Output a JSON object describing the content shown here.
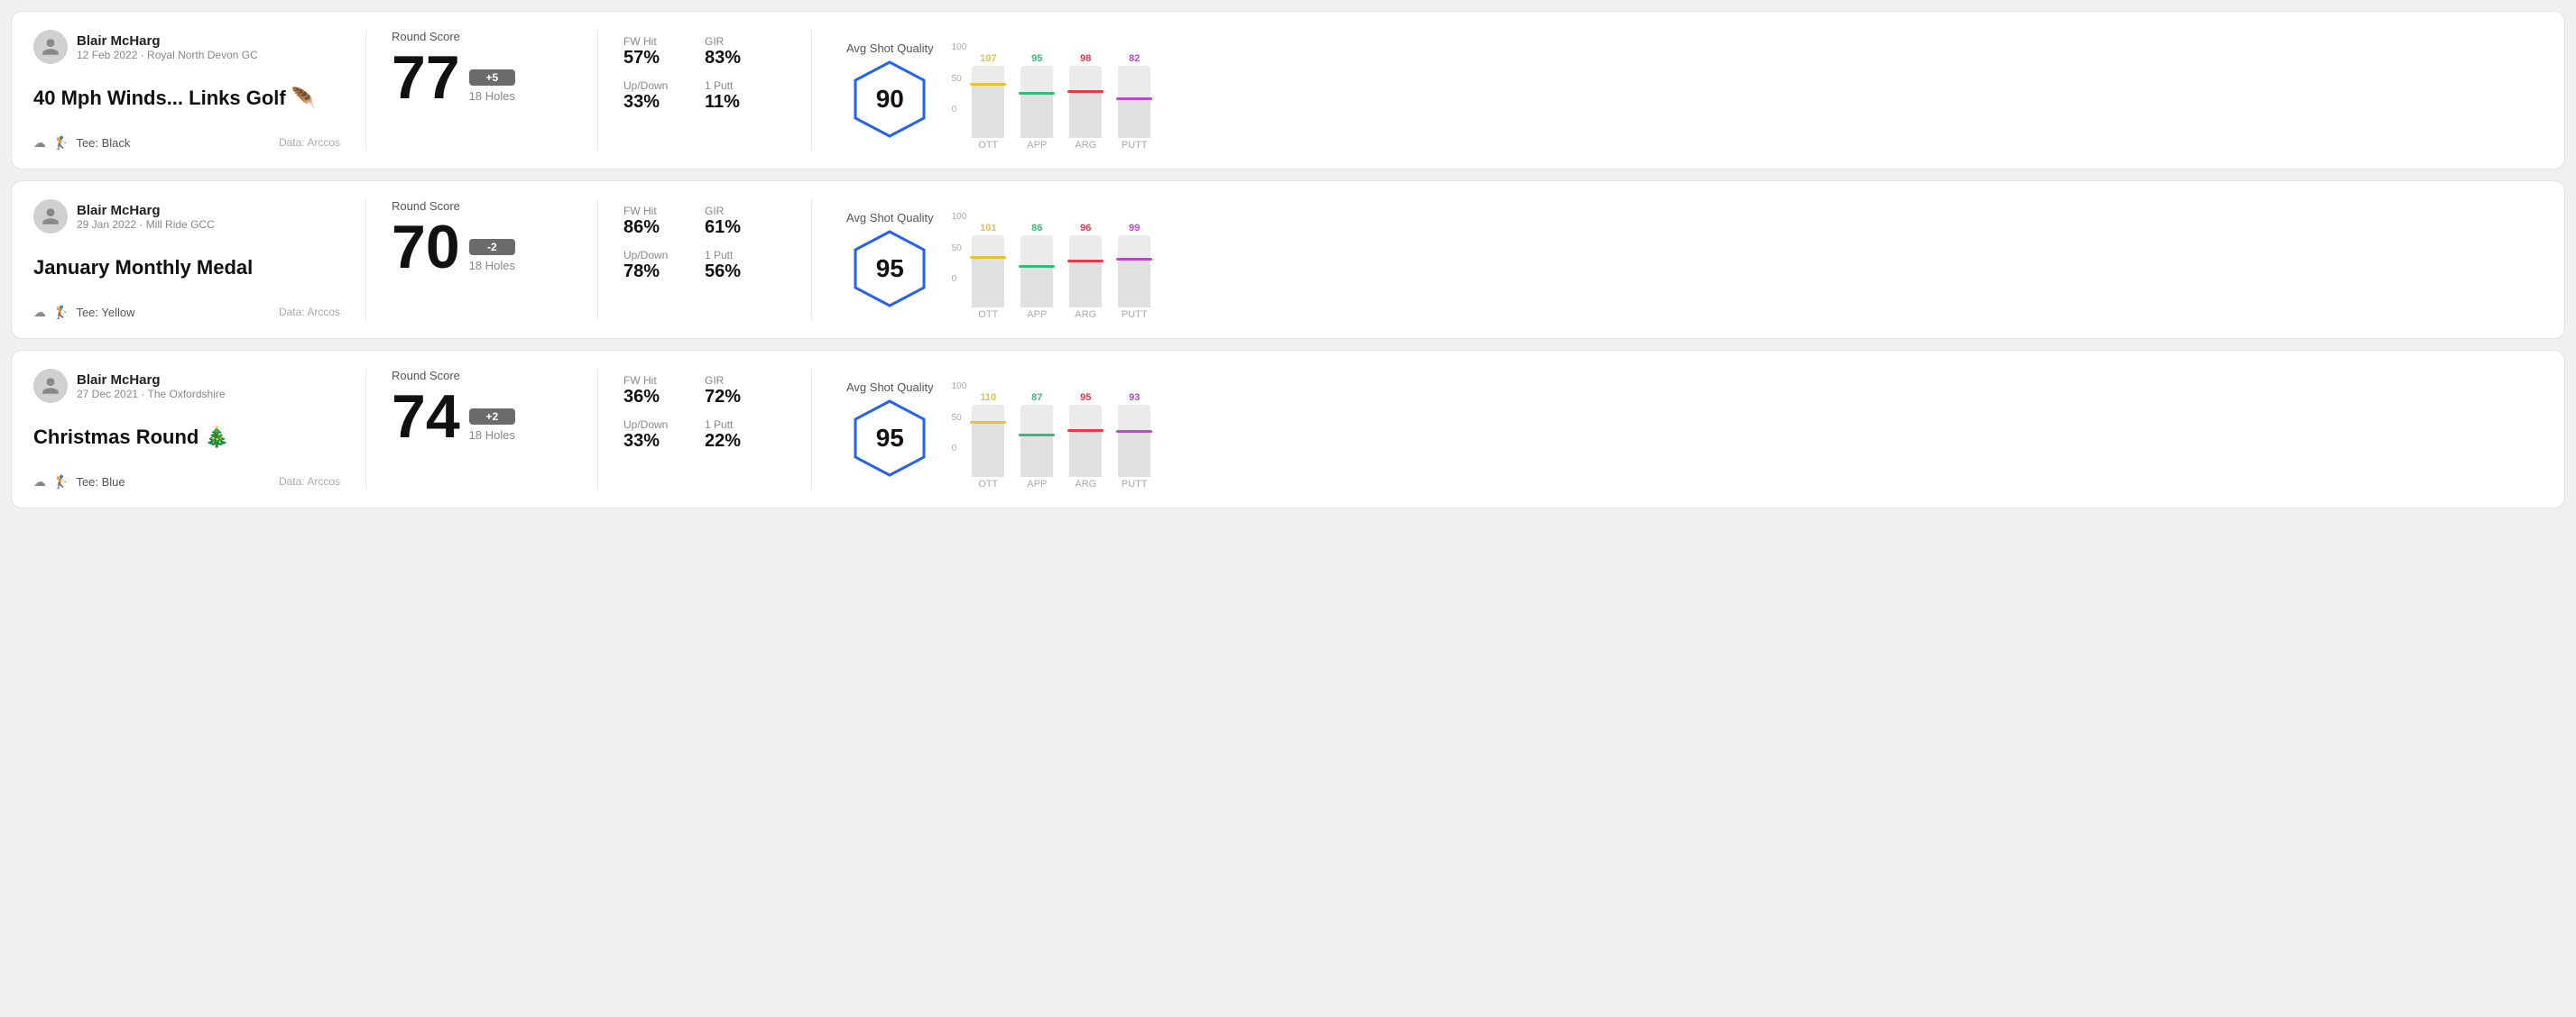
{
  "rounds": [
    {
      "id": "round-1",
      "user": {
        "name": "Blair McHarg",
        "meta": "12 Feb 2022 · Royal North Devon GC"
      },
      "title": "40 Mph Winds... Links Golf 🪶",
      "tee": "Black",
      "data_source": "Data: Arccos",
      "score": {
        "label": "Round Score",
        "value": "77",
        "badge": "+5",
        "badge_type": "over",
        "holes": "18 Holes"
      },
      "stats": [
        {
          "label": "FW Hit",
          "value": "57%"
        },
        {
          "label": "GIR",
          "value": "83%"
        },
        {
          "label": "Up/Down",
          "value": "33%"
        },
        {
          "label": "1 Putt",
          "value": "11%"
        }
      ],
      "quality": {
        "label": "Avg Shot Quality",
        "score": "90"
      },
      "chart": {
        "bars": [
          {
            "label": "OTT",
            "top_label": "107",
            "color": "#e8c230",
            "fill_pct": 72
          },
          {
            "label": "APP",
            "top_label": "95",
            "color": "#3cb878",
            "fill_pct": 60
          },
          {
            "label": "ARG",
            "top_label": "98",
            "color": "#e8394a",
            "fill_pct": 63
          },
          {
            "label": "PUTT",
            "top_label": "82",
            "color": "#b84cc7",
            "fill_pct": 52
          }
        ]
      }
    },
    {
      "id": "round-2",
      "user": {
        "name": "Blair McHarg",
        "meta": "29 Jan 2022 · Mill Ride GCC"
      },
      "title": "January Monthly Medal",
      "tee": "Yellow",
      "data_source": "Data: Arccos",
      "score": {
        "label": "Round Score",
        "value": "70",
        "badge": "-2",
        "badge_type": "under",
        "holes": "18 Holes"
      },
      "stats": [
        {
          "label": "FW Hit",
          "value": "86%"
        },
        {
          "label": "GIR",
          "value": "61%"
        },
        {
          "label": "Up/Down",
          "value": "78%"
        },
        {
          "label": "1 Putt",
          "value": "56%"
        }
      ],
      "quality": {
        "label": "Avg Shot Quality",
        "score": "95"
      },
      "chart": {
        "bars": [
          {
            "label": "OTT",
            "top_label": "101",
            "color": "#e8c230",
            "fill_pct": 68
          },
          {
            "label": "APP",
            "top_label": "86",
            "color": "#3cb878",
            "fill_pct": 55
          },
          {
            "label": "ARG",
            "top_label": "96",
            "color": "#e8394a",
            "fill_pct": 62
          },
          {
            "label": "PUTT",
            "top_label": "99",
            "color": "#b84cc7",
            "fill_pct": 65
          }
        ]
      }
    },
    {
      "id": "round-3",
      "user": {
        "name": "Blair McHarg",
        "meta": "27 Dec 2021 · The Oxfordshire"
      },
      "title": "Christmas Round 🎄",
      "tee": "Blue",
      "data_source": "Data: Arccos",
      "score": {
        "label": "Round Score",
        "value": "74",
        "badge": "+2",
        "badge_type": "over",
        "holes": "18 Holes"
      },
      "stats": [
        {
          "label": "FW Hit",
          "value": "36%"
        },
        {
          "label": "GIR",
          "value": "72%"
        },
        {
          "label": "Up/Down",
          "value": "33%"
        },
        {
          "label": "1 Putt",
          "value": "22%"
        }
      ],
      "quality": {
        "label": "Avg Shot Quality",
        "score": "95"
      },
      "chart": {
        "bars": [
          {
            "label": "OTT",
            "top_label": "110",
            "color": "#e8c230",
            "fill_pct": 74
          },
          {
            "label": "APP",
            "top_label": "87",
            "color": "#3cb878",
            "fill_pct": 56
          },
          {
            "label": "ARG",
            "top_label": "95",
            "color": "#e8394a",
            "fill_pct": 62
          },
          {
            "label": "PUTT",
            "top_label": "93",
            "color": "#b84cc7",
            "fill_pct": 61
          }
        ]
      }
    }
  ],
  "y_axis_labels": [
    "100",
    "50",
    "0"
  ]
}
